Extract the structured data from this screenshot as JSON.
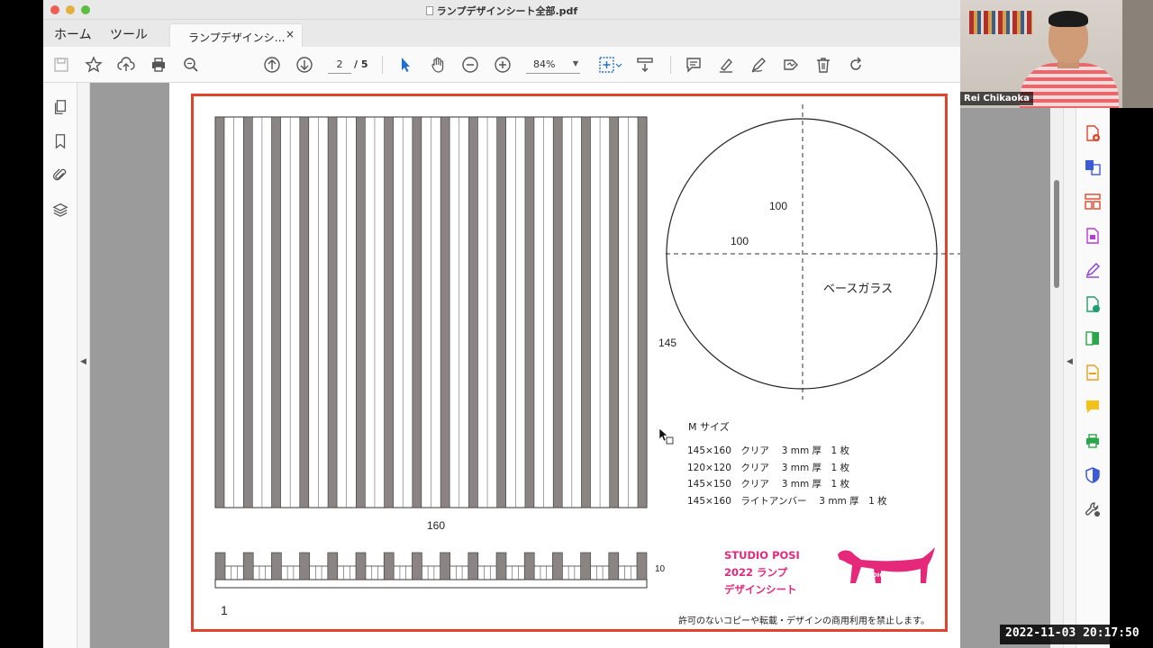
{
  "window": {
    "title": "ランプデザインシート全部.pdf"
  },
  "tabs": {
    "home": "ホーム",
    "tools": "ツール",
    "document": "ランプデザインシ…",
    "close": "×"
  },
  "toolbar": {
    "page_current": "2",
    "page_total": "/ 5",
    "zoom": "84%"
  },
  "document": {
    "dim_100_vertical": "100",
    "dim_100_horizontal": "100",
    "base_glass_label": "ベースガラス",
    "dim_145": "145",
    "dim_160": "160",
    "dim_10": "10",
    "page_number": "1",
    "spec_title": "M サイズ",
    "spec_lines": [
      "145×160　クリア　 3 mm 厚　1 枚",
      "120×120　クリア　 3 mm 厚　1 枚",
      "145×150　クリア　 3 mm 厚　1 枚",
      "145×160　ライトアンバー　 3 mm 厚　1 枚"
    ],
    "brand_line1": "STUDIO POSI",
    "brand_line2": "2022 ランプ",
    "brand_line3": "デザインシート",
    "logo_text": "STUDIO POSI",
    "logo_subtext": "REI CHIKAOKA",
    "copyright": "許可のないコピーや転載・デザインの商用利用を禁止します。",
    "stripe_count": 15,
    "comb_count": 16
  },
  "webcam": {
    "participant_name": "Rei Chikaoka"
  },
  "overlay": {
    "timestamp": "2022-11-03  20:17:50"
  },
  "colors": {
    "frame_red": "#e0452b",
    "brand_pink": "#e5287a",
    "stripe_gray": "#8a8583",
    "accent_blue": "#1f6fd1"
  }
}
